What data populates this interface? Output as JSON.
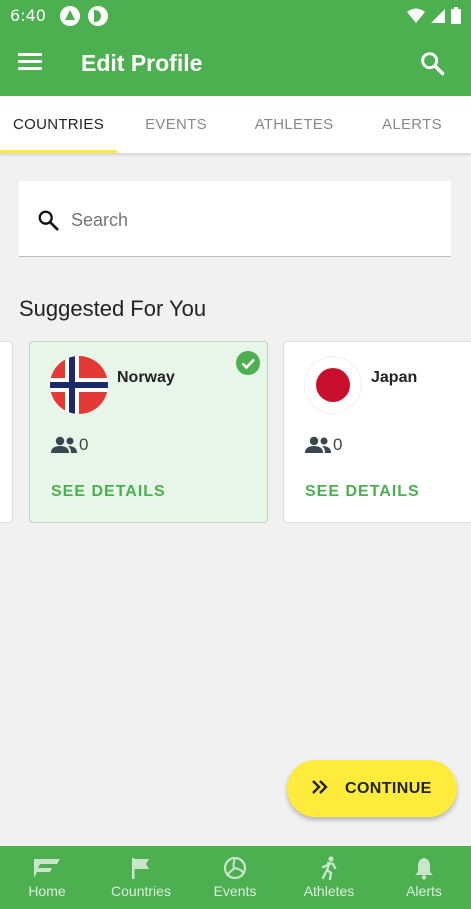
{
  "statusbar": {
    "time": "6:40"
  },
  "appbar": {
    "title": "Edit Profile"
  },
  "tabs": [
    {
      "label": "COUNTRIES",
      "active": true
    },
    {
      "label": "EVENTS",
      "active": false
    },
    {
      "label": "ATHLETES",
      "active": false
    },
    {
      "label": "ALERTS",
      "active": false
    }
  ],
  "search": {
    "placeholder": "Search",
    "value": ""
  },
  "section": {
    "title": "Suggested For You"
  },
  "cards": [
    {
      "name": "Norway",
      "followers": "0",
      "action": "SEE DETAILS",
      "selected": true
    },
    {
      "name": "Japan",
      "followers": "0",
      "action": "SEE DETAILS",
      "selected": false
    }
  ],
  "fab": {
    "label": "CONTINUE"
  },
  "bottomnav": [
    {
      "label": "Home",
      "icon": "home-logo-icon"
    },
    {
      "label": "Countries",
      "icon": "flag-icon"
    },
    {
      "label": "Events",
      "icon": "volleyball-icon"
    },
    {
      "label": "Athletes",
      "icon": "runner-icon"
    },
    {
      "label": "Alerts",
      "icon": "bell-icon"
    }
  ],
  "colors": {
    "primary": "#4caf50",
    "accent": "#ffeb3b",
    "selected_card": "#e8f5e9"
  }
}
